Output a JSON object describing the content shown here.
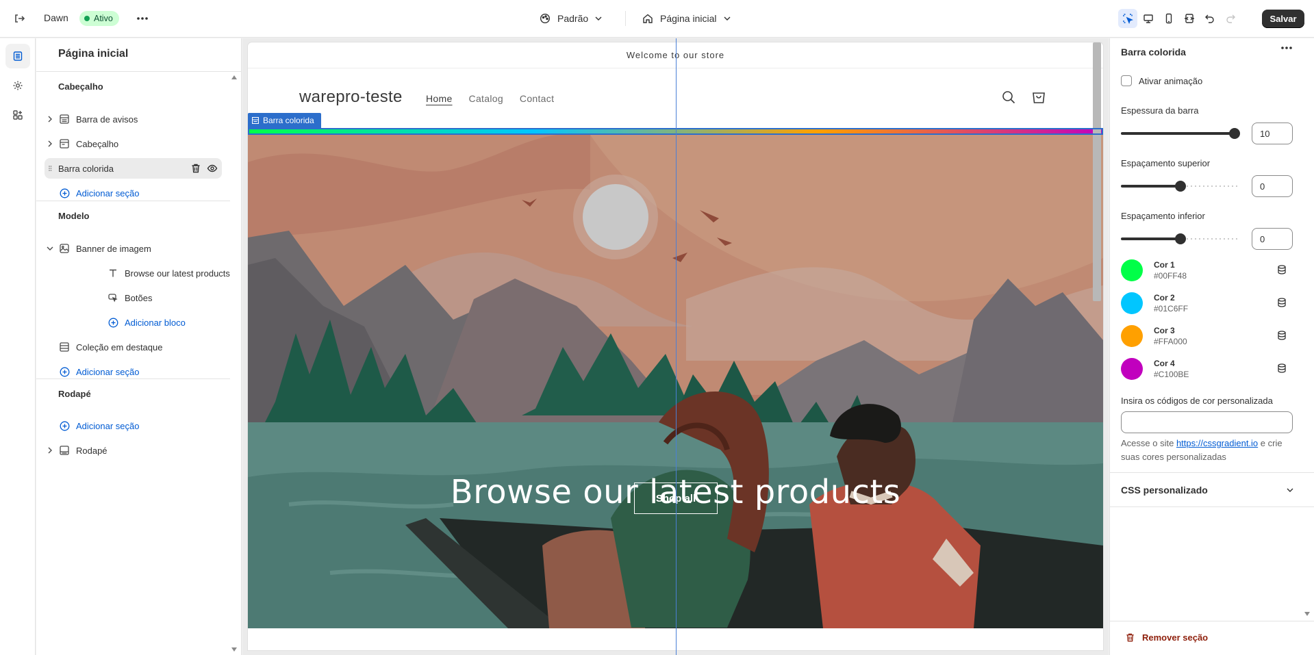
{
  "topbar": {
    "theme_name": "Dawn",
    "status_badge": "Ativo",
    "style_selector": "Padrão",
    "page_selector": "Página inicial",
    "save_label": "Salvar"
  },
  "sidebar": {
    "title": "Página inicial",
    "groups": {
      "header": {
        "title": "Cabeçalho",
        "items": [
          "Barra de avisos",
          "Cabeçalho",
          "Barra colorida"
        ],
        "add_label": "Adicionar seção"
      },
      "template": {
        "title": "Modelo",
        "banner": "Banner de imagem",
        "banner_blocks": [
          "Browse our latest products",
          "Botões"
        ],
        "add_block_label": "Adicionar bloco",
        "featured": "Coleção em destaque",
        "add_label": "Adicionar seção"
      },
      "footer": {
        "title": "Rodapé",
        "add_label": "Adicionar seção",
        "items": [
          "Rodapé"
        ]
      }
    }
  },
  "preview": {
    "announcement": "Welcome to our store",
    "store_name": "warepro-teste",
    "nav": [
      "Home",
      "Catalog",
      "Contact"
    ],
    "section_tag": "Barra colorida",
    "hero_heading": "Browse our latest products",
    "hero_button": "Shop all"
  },
  "settings": {
    "title": "Barra colorida",
    "animation_label": "Ativar animação",
    "animation_enabled": false,
    "thickness": {
      "label": "Espessura da barra",
      "value": "10",
      "level": 1.0
    },
    "padding_top": {
      "label": "Espaçamento superior",
      "value": "0",
      "level": 0.5
    },
    "padding_bottom": {
      "label": "Espaçamento inferior",
      "value": "0",
      "level": 0.5
    },
    "colors": [
      {
        "name": "Cor 1",
        "hex": "#00FF48"
      },
      {
        "name": "Cor 2",
        "hex": "#01C6FF"
      },
      {
        "name": "Cor 3",
        "hex": "#FFA000"
      },
      {
        "name": "Cor 4",
        "hex": "#C100BE"
      }
    ],
    "custom_codes_label": "Insira os códigos de cor personalizada",
    "custom_codes_value": "",
    "hint_prefix": "Acesse o site ",
    "hint_link": "https://cssgradient.io",
    "hint_suffix": " e crie suas cores personalizadas",
    "custom_css_label": "CSS personalizado",
    "remove_label": "Remover seção"
  },
  "colors": {
    "accent_blue": "#005bd3",
    "selection_blue": "#2c6ecb",
    "badge_green": "#cdfed4",
    "danger": "#8e1f0b"
  }
}
